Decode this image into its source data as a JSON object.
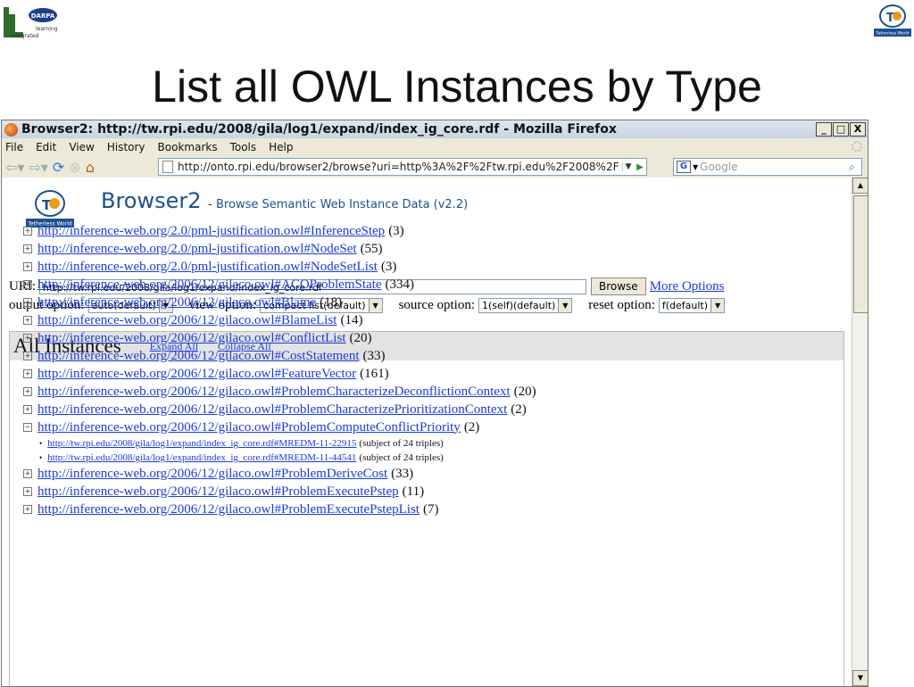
{
  "slide": {
    "title": "List all OWL Instances by Type",
    "logo_left_text": [
      "DARPA",
      "learning",
      "Integrated"
    ],
    "logo_right_text": "Tetherless World"
  },
  "window": {
    "title": "Browser2: http://tw.rpi.edu/2008/gila/log1/expand/index_ig_core.rdf - Mozilla Firefox",
    "buttons": [
      "_",
      "□",
      "X"
    ]
  },
  "menubar": [
    "File",
    "Edit",
    "View",
    "History",
    "Bookmarks",
    "Tools",
    "Help"
  ],
  "navbar": {
    "url": "http://onto.rpi.edu/browser2/browse?uri=http%3A%2F%2Ftw.rpi.edu%2F2008%2F",
    "search_placeholder": "Google",
    "search_engine": "G"
  },
  "page": {
    "logo_text": "Tetherless World",
    "app_name": "Browser2",
    "dash": "-",
    "subtitle": "Browse Semantic Web Instance Data (v2.2)",
    "uri_label": "URI:",
    "uri_value": "http://tw.rpi.edu/2008/gila/log1/expand/index_ig_core.rdf",
    "browse_button": "Browse",
    "more_options": "More Options",
    "options": [
      {
        "label": "output option:",
        "value": "auto(default)"
      },
      {
        "label": "view option:",
        "value": "compact list(default)"
      },
      {
        "label": "source option:",
        "value": "1(self)(default)"
      },
      {
        "label": "reset option:",
        "value": "f(default)"
      }
    ],
    "panel": {
      "heading": "All Instances",
      "expand_all": "Expand All",
      "collapse_all": "Collapse All",
      "types": [
        {
          "url": "http://inference-web.org/2.0/pml-justification.owl#InferenceStep",
          "count": "(3)",
          "expanded": false
        },
        {
          "url": "http://inference-web.org/2.0/pml-justification.owl#NodeSet",
          "count": "(55)",
          "expanded": false
        },
        {
          "url": "http://inference-web.org/2.0/pml-justification.owl#NodeSetList",
          "count": "(3)",
          "expanded": false
        },
        {
          "url": "http://inference-web.org/2006/12/gilaco.owl#ACOProblemState",
          "count": "(334)",
          "expanded": false
        },
        {
          "url": "http://inference-web.org/2006/12/gilaco.owl#Blame",
          "count": "(18)",
          "expanded": false
        },
        {
          "url": "http://inference-web.org/2006/12/gilaco.owl#BlameList",
          "count": "(14)",
          "expanded": false
        },
        {
          "url": "http://inference-web.org/2006/12/gilaco.owl#ConflictList",
          "count": "(20)",
          "expanded": false
        },
        {
          "url": "http://inference-web.org/2006/12/gilaco.owl#CostStatement",
          "count": "(33)",
          "expanded": false
        },
        {
          "url": "http://inference-web.org/2006/12/gilaco.owl#FeatureVector",
          "count": "(161)",
          "expanded": false
        },
        {
          "url": "http://inference-web.org/2006/12/gilaco.owl#ProblemCharacterizeDeconflictionContext",
          "count": "(20)",
          "expanded": false
        },
        {
          "url": "http://inference-web.org/2006/12/gilaco.owl#ProblemCharacterizePrioritizationContext",
          "count": "(2)",
          "expanded": false
        },
        {
          "url": "http://inference-web.org/2006/12/gilaco.owl#ProblemComputeConflictPriority",
          "count": "(2)",
          "expanded": true,
          "instances": [
            {
              "url": "http://tw.rpi.edu/2008/gila/log1/expand/index_ig_core.rdf#MREDM-11-22915",
              "note": "(subject of 24 triples)"
            },
            {
              "url": "http://tw.rpi.edu/2008/gila/log1/expand/index_ig_core.rdf#MREDM-11-44541",
              "note": "(subject of 24 triples)"
            }
          ]
        },
        {
          "url": "http://inference-web.org/2006/12/gilaco.owl#ProblemDeriveCost",
          "count": "(33)",
          "expanded": false
        },
        {
          "url": "http://inference-web.org/2006/12/gilaco.owl#ProblemExecutePstep",
          "count": "(11)",
          "expanded": false
        },
        {
          "url": "http://inference-web.org/2006/12/gilaco.owl#ProblemExecutePstepList",
          "count": "(7)",
          "expanded": false
        }
      ]
    }
  },
  "colors": {
    "link": "#1a3bd8",
    "brand_blue": "#1d4f91",
    "panel_header": "#e3e3e3"
  }
}
